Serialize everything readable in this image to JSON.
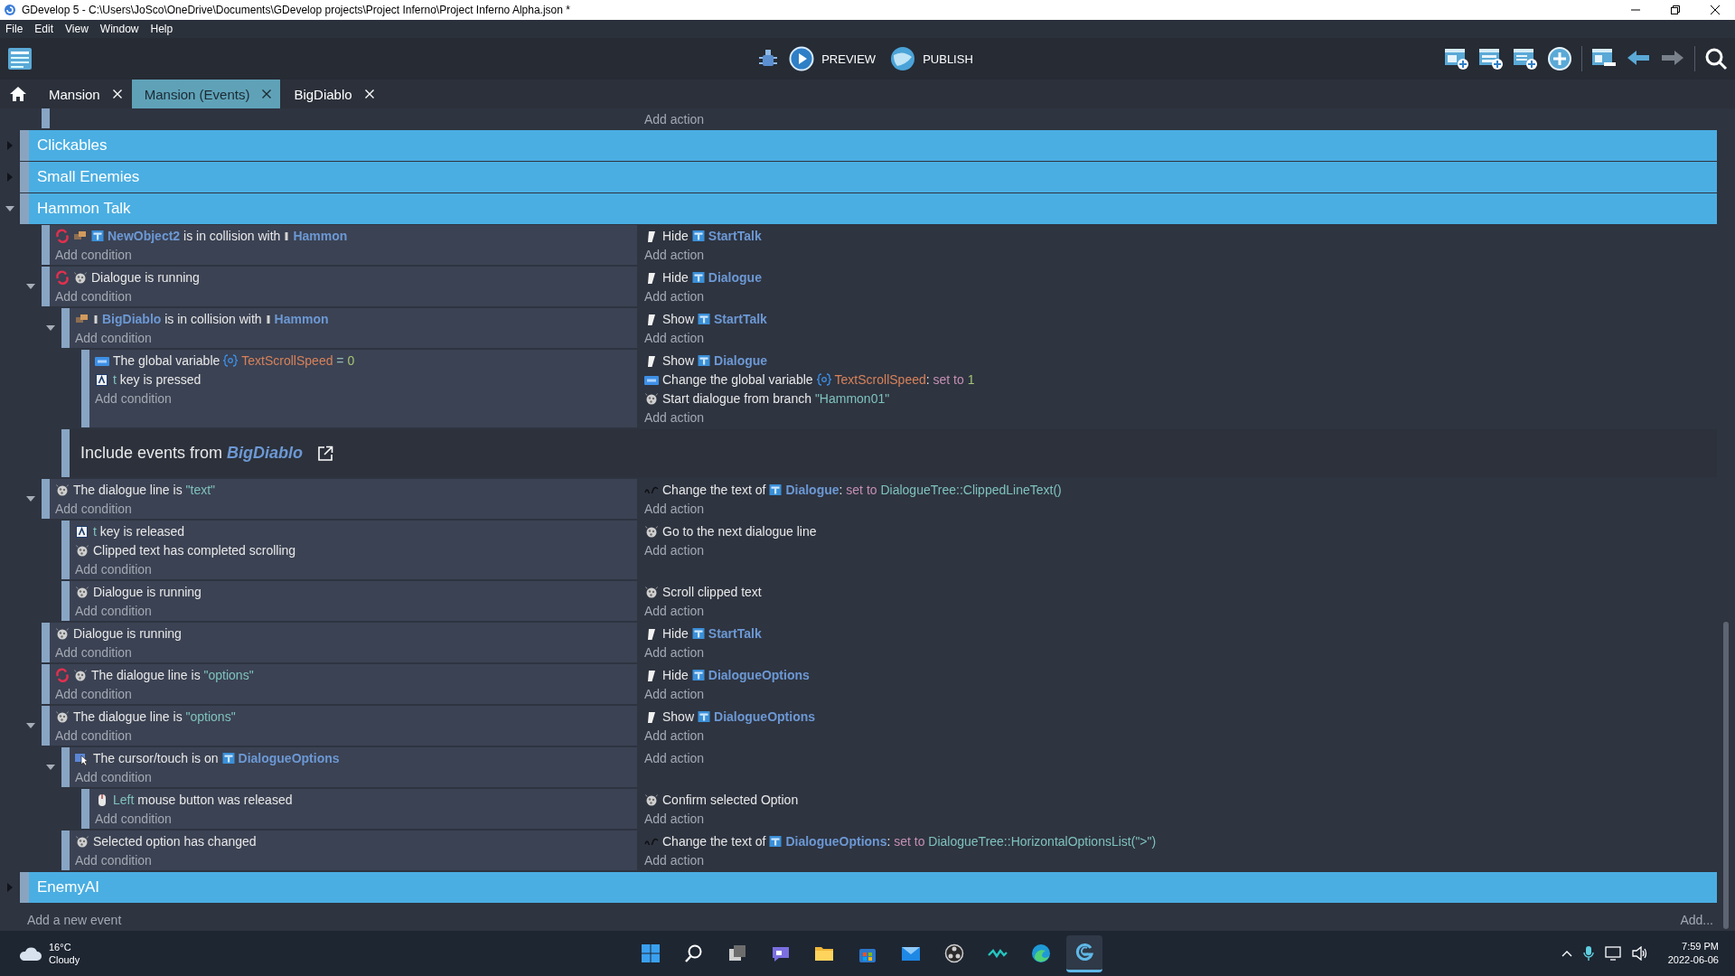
{
  "window": {
    "title": "GDevelop 5 - C:\\Users\\JoSco\\OneDrive\\Documents\\GDevelop projects\\Project Inferno\\Project Inferno Alpha.json *"
  },
  "menu": [
    "File",
    "Edit",
    "View",
    "Window",
    "Help"
  ],
  "toolbar": {
    "preview": "PREVIEW",
    "publish": "PUBLISH",
    "undo": {
      "disabled": false
    },
    "redo": {
      "disabled": true
    }
  },
  "tabs": [
    {
      "label": "Mansion",
      "selected": false
    },
    {
      "label": "Mansion (Events)",
      "selected": true
    },
    {
      "label": "BigDiablo",
      "selected": false
    }
  ],
  "events": {
    "partial_event": {
      "add_action": "Add action"
    },
    "groups": [
      {
        "title": "Clickables",
        "expanded": false
      },
      {
        "title": "Small Enemies",
        "expanded": false
      },
      {
        "title": "Hammon Talk",
        "expanded": true,
        "events": [
          {
            "conditions": [
              {
                "kind": "collision",
                "once": true,
                "parts": [
                  {
                    "kind": "object",
                    "text": "NewObject2"
                  },
                  {
                    "kind": "text",
                    "text": "is in collision with"
                  },
                  {
                    "kind": "sprite",
                    "text": "Hammon"
                  }
                ]
              }
            ],
            "add_condition": "Add condition",
            "actions": [
              {
                "kind": "visibility",
                "parts": [
                  {
                    "kind": "text",
                    "text": "Hide"
                  },
                  {
                    "kind": "object",
                    "text": "StartTalk"
                  }
                ]
              }
            ],
            "add_action": "Add action"
          },
          {
            "expanded": true,
            "conditions": [
              {
                "kind": "extension",
                "once": true,
                "parts": [
                  {
                    "kind": "text",
                    "text": "Dialogue is running"
                  }
                ]
              }
            ],
            "add_condition": "Add condition",
            "actions": [
              {
                "kind": "visibility",
                "parts": [
                  {
                    "kind": "text",
                    "text": "Hide"
                  },
                  {
                    "kind": "object",
                    "text": "Dialogue"
                  }
                ]
              }
            ],
            "add_action": "Add action",
            "children": [
              {
                "expanded": true,
                "conditions": [
                  {
                    "kind": "collision",
                    "once": false,
                    "parts": [
                      {
                        "kind": "sprite",
                        "text": "BigDiablo"
                      },
                      {
                        "kind": "text",
                        "text": "is in collision with"
                      },
                      {
                        "kind": "sprite",
                        "text": "Hammon"
                      }
                    ]
                  }
                ],
                "add_condition": "Add condition",
                "actions": [
                  {
                    "kind": "visibility",
                    "parts": [
                      {
                        "kind": "text",
                        "text": "Show"
                      },
                      {
                        "kind": "object",
                        "text": "StartTalk"
                      }
                    ]
                  }
                ],
                "add_action": "Add action",
                "children": [
                  {
                    "conditions": [
                      {
                        "kind": "variable",
                        "once": false,
                        "parts": [
                          {
                            "kind": "text",
                            "text": "The global variable"
                          },
                          {
                            "kind": "variable",
                            "text": "TextScrollSpeed"
                          },
                          {
                            "kind": "op",
                            "text": "="
                          },
                          {
                            "kind": "number",
                            "text": "0"
                          }
                        ]
                      },
                      {
                        "kind": "keyboard",
                        "once": false,
                        "parts": [
                          {
                            "kind": "param",
                            "text": "t"
                          },
                          {
                            "kind": "text",
                            "text": "key is pressed"
                          }
                        ]
                      }
                    ],
                    "add_condition": "Add condition",
                    "actions": [
                      {
                        "kind": "visibility",
                        "parts": [
                          {
                            "kind": "text",
                            "text": "Show"
                          },
                          {
                            "kind": "object",
                            "text": "Dialogue"
                          }
                        ]
                      },
                      {
                        "kind": "variable",
                        "parts": [
                          {
                            "kind": "text",
                            "text": "Change the global variable"
                          },
                          {
                            "kind": "variable",
                            "text": "TextScrollSpeed"
                          },
                          {
                            "kind": "colon",
                            "text": ":"
                          },
                          {
                            "kind": "keyword",
                            "text": "set to"
                          },
                          {
                            "kind": "number",
                            "text": "1"
                          }
                        ]
                      },
                      {
                        "kind": "extension",
                        "parts": [
                          {
                            "kind": "text",
                            "text": "Start dialogue from branch"
                          },
                          {
                            "kind": "string",
                            "text": "\"Hammon01\""
                          }
                        ]
                      }
                    ],
                    "add_action": "Add action"
                  }
                ]
              },
              {
                "label": "Include events from",
                "target": "BigDiablo"
              }
            ]
          },
          {
            "expanded": true,
            "conditions": [
              {
                "kind": "extension",
                "once": false,
                "parts": [
                  {
                    "kind": "text",
                    "text": "The dialogue line is"
                  },
                  {
                    "kind": "string",
                    "text": "\"text\""
                  }
                ]
              }
            ],
            "add_condition": "Add condition",
            "actions": [
              {
                "kind": "text",
                "parts": [
                  {
                    "kind": "text",
                    "text": "Change the text of"
                  },
                  {
                    "kind": "object",
                    "text": "Dialogue"
                  },
                  {
                    "kind": "colon",
                    "text": ":"
                  },
                  {
                    "kind": "keyword",
                    "text": "set to"
                  },
                  {
                    "kind": "string",
                    "text": "DialogueTree::ClippedLineText()"
                  }
                ]
              }
            ],
            "add_action": "Add action",
            "children": [
              {
                "conditions": [
                  {
                    "kind": "keyboard",
                    "once": false,
                    "parts": [
                      {
                        "kind": "param",
                        "text": "t"
                      },
                      {
                        "kind": "text",
                        "text": "key is released"
                      }
                    ]
                  },
                  {
                    "kind": "extension",
                    "once": false,
                    "parts": [
                      {
                        "kind": "text",
                        "text": "Clipped text has completed scrolling"
                      }
                    ]
                  }
                ],
                "add_condition": "Add condition",
                "actions": [
                  {
                    "kind": "extension",
                    "parts": [
                      {
                        "kind": "text",
                        "text": "Go to the next dialogue line"
                      }
                    ]
                  }
                ],
                "add_action": "Add action"
              },
              {
                "conditions": [
                  {
                    "kind": "extension",
                    "once": false,
                    "parts": [
                      {
                        "kind": "text",
                        "text": "Dialogue is running"
                      }
                    ]
                  }
                ],
                "add_condition": "Add condition",
                "actions": [
                  {
                    "kind": "extension",
                    "parts": [
                      {
                        "kind": "text",
                        "text": "Scroll clipped text"
                      }
                    ]
                  }
                ],
                "add_action": "Add action"
              }
            ]
          },
          {
            "conditions": [
              {
                "kind": "extension",
                "once": false,
                "parts": [
                  {
                    "kind": "text",
                    "text": "Dialogue is running"
                  }
                ]
              }
            ],
            "add_condition": "Add condition",
            "actions": [
              {
                "kind": "visibility",
                "parts": [
                  {
                    "kind": "text",
                    "text": "Hide"
                  },
                  {
                    "kind": "object",
                    "text": "StartTalk"
                  }
                ]
              }
            ],
            "add_action": "Add action"
          },
          {
            "conditions": [
              {
                "kind": "extension",
                "once": true,
                "parts": [
                  {
                    "kind": "text",
                    "text": "The dialogue line is"
                  },
                  {
                    "kind": "string",
                    "text": "\"options\""
                  }
                ]
              }
            ],
            "add_condition": "Add condition",
            "actions": [
              {
                "kind": "visibility",
                "parts": [
                  {
                    "kind": "text",
                    "text": "Hide"
                  },
                  {
                    "kind": "object",
                    "text": "DialogueOptions"
                  }
                ]
              }
            ],
            "add_action": "Add action"
          },
          {
            "expanded": true,
            "conditions": [
              {
                "kind": "extension",
                "once": false,
                "parts": [
                  {
                    "kind": "text",
                    "text": "The dialogue line is"
                  },
                  {
                    "kind": "string",
                    "text": "\"options\""
                  }
                ]
              }
            ],
            "add_condition": "Add condition",
            "actions": [
              {
                "kind": "visibility",
                "parts": [
                  {
                    "kind": "text",
                    "text": "Show"
                  },
                  {
                    "kind": "object",
                    "text": "DialogueOptions"
                  }
                ]
              }
            ],
            "add_action": "Add action",
            "children": [
              {
                "expanded": true,
                "conditions": [
                  {
                    "kind": "cursor",
                    "once": false,
                    "parts": [
                      {
                        "kind": "text",
                        "text": "The cursor/touch is on"
                      },
                      {
                        "kind": "object",
                        "text": "DialogueOptions"
                      }
                    ]
                  }
                ],
                "add_condition": "Add condition",
                "add_action": "Add action",
                "children": [
                  {
                    "conditions": [
                      {
                        "kind": "mouse",
                        "once": false,
                        "parts": [
                          {
                            "kind": "param",
                            "text": "Left"
                          },
                          {
                            "kind": "text",
                            "text": "mouse button was released"
                          }
                        ]
                      }
                    ],
                    "add_condition": "Add condition",
                    "actions": [
                      {
                        "kind": "extension",
                        "parts": [
                          {
                            "kind": "text",
                            "text": "Confirm selected Option"
                          }
                        ]
                      }
                    ],
                    "add_action": "Add action"
                  }
                ]
              },
              {
                "conditions": [
                  {
                    "kind": "extension",
                    "once": false,
                    "parts": [
                      {
                        "kind": "text",
                        "text": "Selected option has changed"
                      }
                    ]
                  }
                ],
                "add_condition": "Add condition",
                "actions": [
                  {
                    "kind": "text",
                    "parts": [
                      {
                        "kind": "text",
                        "text": "Change the text of"
                      },
                      {
                        "kind": "object",
                        "text": "DialogueOptions"
                      },
                      {
                        "kind": "colon",
                        "text": ":"
                      },
                      {
                        "kind": "keyword",
                        "text": "set to"
                      },
                      {
                        "kind": "string",
                        "text": "DialogueTree::HorizontalOptionsList(\">\")"
                      }
                    ]
                  }
                ],
                "add_action": "Add action"
              }
            ]
          }
        ]
      },
      {
        "title": "EnemyAI",
        "expanded": false
      }
    ],
    "add_event": "Add a new event",
    "add_more": "Add..."
  },
  "taskbar": {
    "temperature": "16°C",
    "weather": "Cloudy",
    "time": "7:59 PM",
    "date": "2022-06-06"
  }
}
